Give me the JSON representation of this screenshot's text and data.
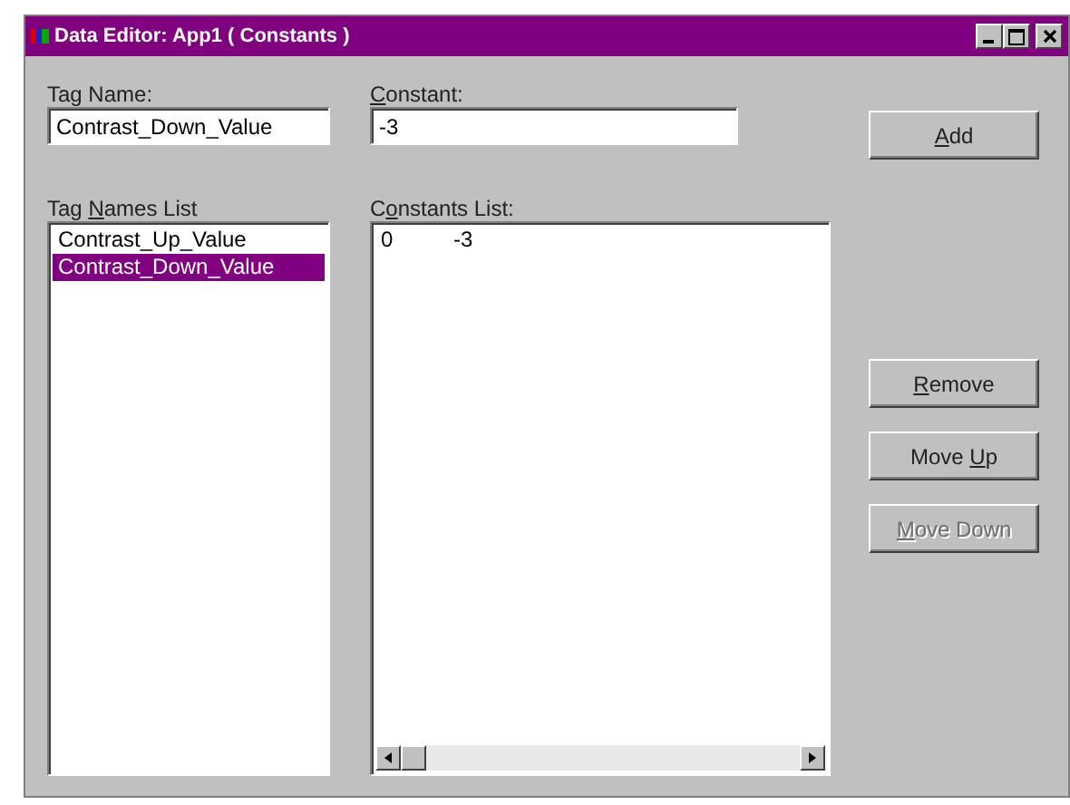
{
  "window": {
    "title": "Data Editor: App1 ( Constants )"
  },
  "tag_name": {
    "label": {
      "before": "Tag Name:"
    },
    "value": "Contrast_Down_Value"
  },
  "constant": {
    "label": {
      "key": "C",
      "after": "onstant:"
    },
    "value": "-3"
  },
  "tag_names_list": {
    "label": {
      "before": "Tag ",
      "key": "N",
      "after": "ames List"
    },
    "items": [
      {
        "text": "Contrast_Up_Value",
        "selected": false
      },
      {
        "text": "Contrast_Down_Value",
        "selected": true
      }
    ]
  },
  "constants_list": {
    "label": {
      "before": "C",
      "key": "o",
      "after": "nstants List:"
    },
    "rows": [
      {
        "index": "0",
        "value": "-3"
      }
    ]
  },
  "buttons": [
    {
      "label": {
        "key": "A",
        "after": "dd"
      },
      "disabled": false,
      "kind": "top"
    },
    {
      "label": {
        "key": "R",
        "after": "emove"
      },
      "disabled": false,
      "kind": "lower"
    },
    {
      "label": {
        "before": "Move ",
        "key": "U",
        "after": "p"
      },
      "disabled": false,
      "kind": "lower"
    },
    {
      "label": {
        "key": "M",
        "after": "ove Down"
      },
      "disabled": true,
      "kind": "lower"
    }
  ]
}
